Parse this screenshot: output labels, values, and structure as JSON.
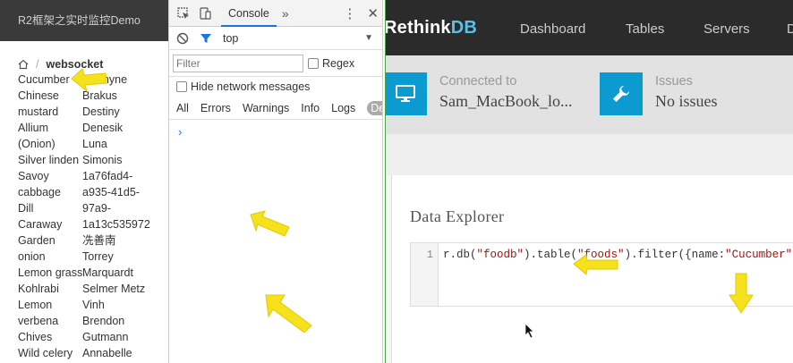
{
  "left": {
    "header_title": "R2框架之实时监控Demo",
    "breadcrumb_current": "websocket",
    "breadcrumb_sep": "/",
    "rows": [
      [
        "Cucumber",
        "Jazmyne"
      ],
      [
        "Chinese",
        "Brakus"
      ],
      [
        "mustard",
        "Destiny"
      ],
      [
        "Allium",
        "Denesik"
      ],
      [
        "(Onion)",
        "Luna"
      ],
      [
        "Silver linden",
        "Simonis"
      ],
      [
        "Savoy",
        "1a76fad4-"
      ],
      [
        "cabbage",
        "a935-41d5-"
      ],
      [
        "Dill",
        "97a9-"
      ],
      [
        "Caraway",
        "1a13c5359729"
      ],
      [
        "Garden",
        "冼善南"
      ],
      [
        "onion",
        "Torrey"
      ],
      [
        "Lemon grass",
        "Marquardt"
      ],
      [
        "Kohlrabi",
        "Selmer Metz"
      ],
      [
        "Lemon",
        "Vinh"
      ],
      [
        "verbena",
        "Brendon"
      ],
      [
        "Chives",
        "Gutmann"
      ],
      [
        "Wild celery",
        "Annabelle"
      ]
    ]
  },
  "devtools": {
    "tab_console": "Console",
    "more_tabs": "»",
    "kebab": "⋮",
    "close": "✕",
    "context": "top",
    "filter_placeholder": "Filter",
    "regex_label": "Regex",
    "hide_network_label": "Hide network messages",
    "levels": [
      "All",
      "Errors",
      "Warnings",
      "Info",
      "Logs"
    ],
    "debug_label": "Debu",
    "prompt": "›"
  },
  "rethinkdb": {
    "logo_a": "Rethink",
    "logo_b": "DB",
    "nav": [
      "Dashboard",
      "Tables",
      "Servers",
      "D"
    ],
    "connected_label": "Connected to",
    "connected_value": "Sam_MacBook_lo...",
    "issues_label": "Issues",
    "issues_value": "No issues",
    "explorer_title": "Data Explorer",
    "line_number": "1",
    "code_prefix": "r.db(",
    "code_db": "\"foodb\"",
    "code_mid": ").table(",
    "code_table": "\"foods\"",
    "code_filter": ").filter({name:",
    "code_value": "\"Cucumber\""
  },
  "colors": {
    "accent_blue": "#0b9bd1",
    "arrow_yellow": "#f5e21c",
    "nav_dark": "#2b2b2b"
  }
}
